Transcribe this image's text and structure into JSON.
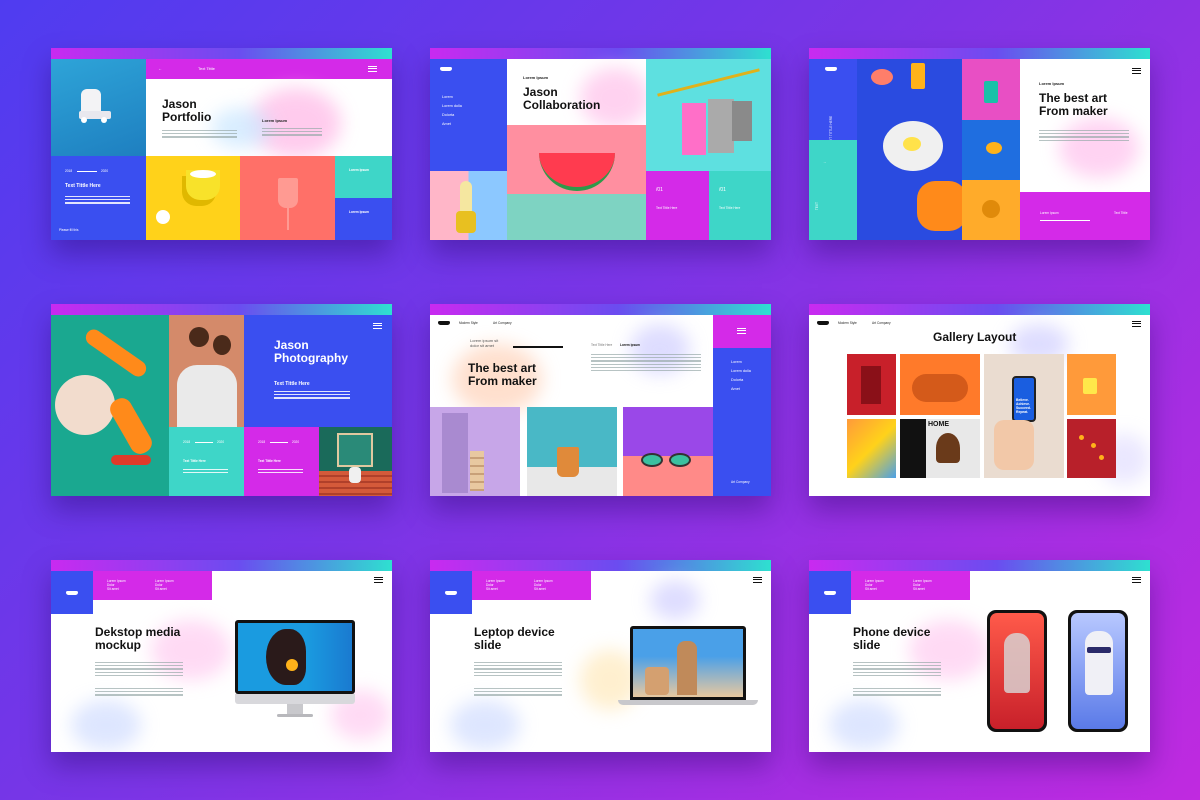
{
  "slides": {
    "s1": {
      "nav_title": "Text Tittle",
      "title_line1": "Jason",
      "title_line2": "Portfolio",
      "lorem_heading": "Lorem Ipsum",
      "year_start": "2018",
      "year_end": "2020",
      "card_title": "Text Tittle Here",
      "box1": "Lorem Ipsum",
      "box2": "Lorem Ipsum",
      "footer": "Please fill this"
    },
    "s2": {
      "nav": [
        "Lorem",
        "Lorem dolla",
        "Dolorta",
        "Amet"
      ],
      "kicker": "Lorem Ipsum",
      "title_line1": "Jason",
      "title_line2": "Collaboration",
      "num1": "/01",
      "num2": "/01",
      "caption1": "Text Tittle Here",
      "caption2": "Text Tittle Here"
    },
    "s3": {
      "vertical_label": "TEXT TITTLE HERE",
      "vertical_label2": "TEXT",
      "kicker": "Lorem Ipsum",
      "title_line1": "The best art",
      "title_line2": "From maker",
      "footer_left": "Lorem Ipsum",
      "footer_right": "Text Tittle"
    },
    "s4": {
      "title_line1": "Jason",
      "title_line2": "Photography",
      "subtitle": "Text Tittle Here",
      "year_start": "2018",
      "year_end": "2020",
      "year_start2": "2018",
      "year_end2": "2020",
      "card1": "Text Tittle Here",
      "card2": "Text Tittle Here"
    },
    "s5": {
      "brand": "Modern Style",
      "brand2": "Art Company",
      "kicker1": "Lorem ipsum sit",
      "kicker2": "dolor sit amet",
      "title_line1": "The best art",
      "title_line2": "From maker",
      "col_label1": "Text Tittle Here",
      "col_label2": "Lorem ipsum",
      "nav": [
        "Lorem",
        "Lorem dolla",
        "Dolorta",
        "Amet"
      ],
      "footer": "Art Company"
    },
    "s6": {
      "brand": "Modern Style",
      "brand2": "Art Company",
      "title": "Gallery Layout",
      "phone_text": "Believe. Achieve. Succeed. Repeat.",
      "poster_text": "HOME"
    },
    "s7": {
      "header_col1": [
        "Lorem Ipsum",
        "Dolor",
        "Sit amet"
      ],
      "header_col2": [
        "Lorem Ipsum",
        "Dolor",
        "Sit amet"
      ],
      "title_line1": "Dekstop media",
      "title_line2": "mockup"
    },
    "s8": {
      "header_col1": [
        "Lorem Ipsum",
        "Dolor",
        "Sit amet"
      ],
      "header_col2": [
        "Lorem Ipsum",
        "Dolor",
        "Sit amet"
      ],
      "title_line1": "Leptop device",
      "title_line2": "slide"
    },
    "s9": {
      "header_col1": [
        "Lorem Ipsum",
        "Dolor",
        "Sit amet"
      ],
      "header_col2": [
        "Lorem Ipsum",
        "Dolor",
        "Sit amet"
      ],
      "title_line1": "Phone device",
      "title_line2": "slide"
    }
  },
  "colors": {
    "blue": "#3a4ff0",
    "magenta": "#d42ae8",
    "teal": "#3ed6c8",
    "yellow": "#ffd21a",
    "coral": "#ff6f6a",
    "bg_start": "#4f3cf0",
    "bg_end": "#c02ae0"
  }
}
